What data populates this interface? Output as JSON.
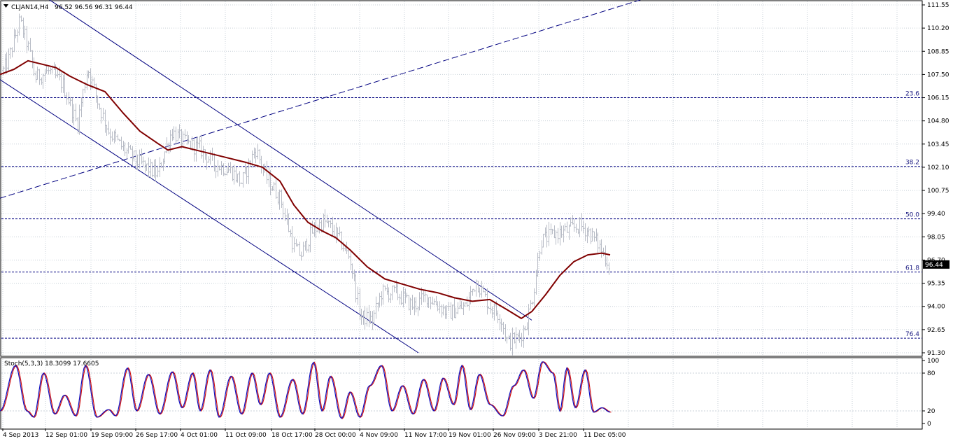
{
  "header": {
    "symbol": "CLJAN14,H4",
    "ohlc": "96.52 96.56 96.31 96.44"
  },
  "stoch_header": "Stoch(5,3,3) 18.3099 17.6605",
  "colors": {
    "background": "#ffffff",
    "bar": "#b8bcc6",
    "ma": "#800000",
    "channel": "#000080",
    "fib": "#000080",
    "grid": "#c8d0d8",
    "stoch_main": "#1010c0",
    "stoch_signal": "#d01010",
    "price_tag": "#000000"
  },
  "chart_data": [
    {
      "type": "candlestick",
      "title": "CLJAN14,H4",
      "y_ticks": [
        "111.55",
        "110.20",
        "108.85",
        "107.50",
        "106.15",
        "104.80",
        "103.45",
        "102.10",
        "100.75",
        "99.40",
        "98.05",
        "96.70",
        "95.35",
        "94.00",
        "92.65",
        "91.30"
      ],
      "x_ticks": [
        "4 Sep 2013",
        "12 Sep 01:00",
        "19 Sep 09:00",
        "26 Sep 17:00",
        "4 Oct 01:00",
        "11 Oct 09:00",
        "18 Oct 17:00",
        "28 Oct 00:00",
        "4 Nov 09:00",
        "11 Nov 17:00",
        "19 Nov 01:00",
        "26 Nov 09:00",
        "3 Dec 21:00",
        "11 Dec 05:00"
      ],
      "ylim": [
        91.0,
        111.9
      ],
      "current_price": "96.44",
      "fibonacci_levels": [
        {
          "label": "23.6",
          "price": 106.15
        },
        {
          "label": "38.2",
          "price": 102.15
        },
        {
          "label": "50.0",
          "price": 99.1
        },
        {
          "label": "61.8",
          "price": 96.0
        },
        {
          "label": "76.4",
          "price": 92.15
        }
      ],
      "price_path": [
        [
          0,
          107.4
        ],
        [
          12,
          108.4
        ],
        [
          28,
          110.6
        ],
        [
          40,
          109.1
        ],
        [
          50,
          107.3
        ],
        [
          70,
          107.7
        ],
        [
          90,
          106.9
        ],
        [
          110,
          104.6
        ],
        [
          125,
          107.9
        ],
        [
          140,
          105.8
        ],
        [
          155,
          104.2
        ],
        [
          175,
          103.2
        ],
        [
          200,
          102.3
        ],
        [
          225,
          101.7
        ],
        [
          245,
          104.2
        ],
        [
          265,
          103.5
        ],
        [
          285,
          103.2
        ],
        [
          305,
          102.3
        ],
        [
          330,
          101.9
        ],
        [
          345,
          101.2
        ],
        [
          365,
          103.2
        ],
        [
          380,
          101.5
        ],
        [
          400,
          100.3
        ],
        [
          420,
          97.4
        ],
        [
          430,
          97.0
        ],
        [
          445,
          98.3
        ],
        [
          462,
          99.0
        ],
        [
          480,
          98.2
        ],
        [
          500,
          96.8
        ],
        [
          515,
          93.4
        ],
        [
          532,
          93.2
        ],
        [
          545,
          94.8
        ],
        [
          565,
          94.8
        ],
        [
          590,
          94.0
        ],
        [
          610,
          94.6
        ],
        [
          640,
          93.6
        ],
        [
          665,
          94.0
        ],
        [
          680,
          95.5
        ],
        [
          698,
          94.1
        ],
        [
          715,
          93.4
        ],
        [
          725,
          91.9
        ],
        [
          742,
          92.2
        ],
        [
          752,
          93.0
        ],
        [
          762,
          94.8
        ],
        [
          772,
          97.8
        ],
        [
          790,
          98.2
        ],
        [
          810,
          98.4
        ],
        [
          828,
          98.7
        ],
        [
          840,
          98.4
        ],
        [
          855,
          97.6
        ],
        [
          870,
          96.44
        ]
      ],
      "ma_path": [
        [
          0,
          107.5
        ],
        [
          20,
          107.8
        ],
        [
          40,
          108.3
        ],
        [
          60,
          108.1
        ],
        [
          80,
          107.9
        ],
        [
          100,
          107.4
        ],
        [
          125,
          106.9
        ],
        [
          150,
          106.5
        ],
        [
          175,
          105.3
        ],
        [
          200,
          104.2
        ],
        [
          225,
          103.5
        ],
        [
          240,
          103.1
        ],
        [
          260,
          103.3
        ],
        [
          290,
          103.0
        ],
        [
          320,
          102.7
        ],
        [
          350,
          102.4
        ],
        [
          375,
          102.1
        ],
        [
          400,
          101.3
        ],
        [
          420,
          99.9
        ],
        [
          440,
          98.9
        ],
        [
          460,
          98.4
        ],
        [
          480,
          98.0
        ],
        [
          500,
          97.3
        ],
        [
          525,
          96.3
        ],
        [
          550,
          95.6
        ],
        [
          575,
          95.3
        ],
        [
          600,
          95.0
        ],
        [
          625,
          94.8
        ],
        [
          650,
          94.5
        ],
        [
          675,
          94.3
        ],
        [
          700,
          94.4
        ],
        [
          725,
          93.8
        ],
        [
          745,
          93.3
        ],
        [
          760,
          93.7
        ],
        [
          780,
          94.7
        ],
        [
          800,
          95.8
        ],
        [
          820,
          96.6
        ],
        [
          840,
          97.0
        ],
        [
          860,
          97.1
        ],
        [
          872,
          97.0
        ]
      ],
      "channel_lines": [
        {
          "from": [
            65,
            112.0
          ],
          "to": [
            760,
            93.2
          ],
          "dash": false
        },
        {
          "from": [
            0,
            107.2
          ],
          "to": [
            598,
            91.3
          ],
          "dash": false
        },
        {
          "from": [
            0,
            100.3
          ],
          "to": [
            920,
            111.9
          ],
          "dash": true
        }
      ]
    },
    {
      "type": "line",
      "title": "Stoch(5,3,3)",
      "y_ticks": [
        "100",
        "80",
        "20",
        "0"
      ],
      "ylim": [
        0,
        100
      ],
      "main_value": "18.3099",
      "signal_value": "17.6605",
      "turning_points": [
        [
          0,
          20
        ],
        [
          22,
          92
        ],
        [
          38,
          20
        ],
        [
          48,
          10
        ],
        [
          62,
          80
        ],
        [
          78,
          15
        ],
        [
          92,
          45
        ],
        [
          108,
          12
        ],
        [
          122,
          92
        ],
        [
          138,
          10
        ],
        [
          155,
          22
        ],
        [
          165,
          12
        ],
        [
          182,
          88
        ],
        [
          195,
          20
        ],
        [
          212,
          78
        ],
        [
          228,
          15
        ],
        [
          246,
          82
        ],
        [
          260,
          25
        ],
        [
          275,
          80
        ],
        [
          286,
          20
        ],
        [
          300,
          85
        ],
        [
          313,
          10
        ],
        [
          330,
          75
        ],
        [
          345,
          15
        ],
        [
          360,
          80
        ],
        [
          372,
          30
        ],
        [
          385,
          80
        ],
        [
          400,
          10
        ],
        [
          418,
          70
        ],
        [
          432,
          15
        ],
        [
          448,
          97
        ],
        [
          460,
          20
        ],
        [
          472,
          75
        ],
        [
          488,
          8
        ],
        [
          500,
          50
        ],
        [
          514,
          10
        ],
        [
          528,
          60
        ],
        [
          545,
          92
        ],
        [
          560,
          20
        ],
        [
          575,
          60
        ],
        [
          590,
          15
        ],
        [
          605,
          70
        ],
        [
          620,
          20
        ],
        [
          633,
          72
        ],
        [
          648,
          30
        ],
        [
          660,
          92
        ],
        [
          672,
          22
        ],
        [
          685,
          78
        ],
        [
          700,
          30
        ],
        [
          718,
          12
        ],
        [
          734,
          60
        ],
        [
          748,
          85
        ],
        [
          762,
          40
        ],
        [
          775,
          98
        ],
        [
          790,
          80
        ],
        [
          800,
          20
        ],
        [
          810,
          88
        ],
        [
          822,
          25
        ],
        [
          836,
          85
        ],
        [
          848,
          18
        ],
        [
          860,
          25
        ],
        [
          872,
          18
        ]
      ]
    }
  ]
}
